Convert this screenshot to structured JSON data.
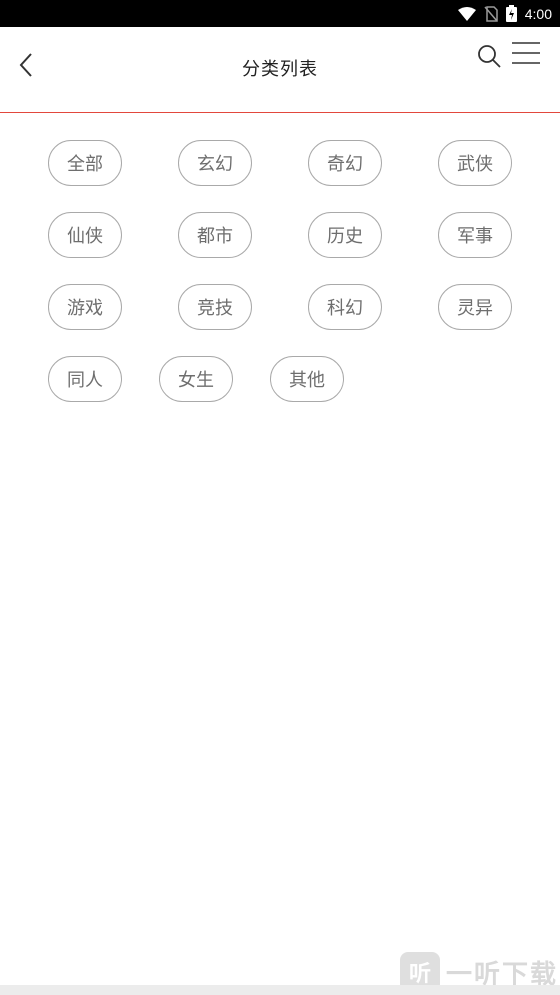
{
  "status_bar": {
    "time": "4:00",
    "icons": [
      "wifi-icon",
      "no-sim-icon",
      "battery-charging-icon"
    ]
  },
  "header": {
    "title": "分类列表",
    "back_icon": "chevron-left-icon",
    "search_icon": "search-icon",
    "menu_icon": "hamburger-menu-icon",
    "accent_color": "#e2483d"
  },
  "categories": [
    {
      "label": "全部"
    },
    {
      "label": "玄幻"
    },
    {
      "label": "奇幻"
    },
    {
      "label": "武侠"
    },
    {
      "label": "仙侠"
    },
    {
      "label": "都市"
    },
    {
      "label": "历史"
    },
    {
      "label": "军事"
    },
    {
      "label": "游戏"
    },
    {
      "label": "竞技"
    },
    {
      "label": "科幻"
    },
    {
      "label": "灵异"
    },
    {
      "label": "同人"
    },
    {
      "label": "女生"
    },
    {
      "label": "其他"
    }
  ],
  "watermark": {
    "logo_text": "听",
    "text": "一听下载"
  }
}
